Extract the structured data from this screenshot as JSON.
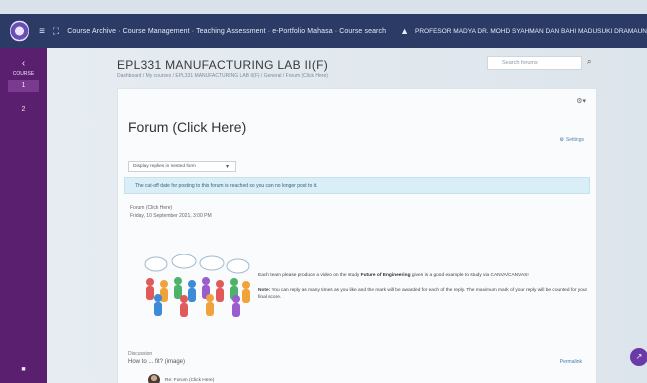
{
  "topbar": {
    "crumbs": "Course Archive  ·  Course Management  ·  Teaching Assessment  ·  e-Portfolio Mahasa  ·  Course search",
    "user": "PROFESOR MADYA DR. MOHD SYAHMAN DAN BAHI MADUSUKI DRAMAUN"
  },
  "sidebar": {
    "back_label": "COURSE",
    "items": [
      "1",
      "2"
    ]
  },
  "course": {
    "title": "EPL331 MANUFACTURING LAB II(F)",
    "breadcrumb": "Dashboard  /  My courses  /  EPL331 MANUFACTURING LAB II(F)  /  General  /  Forum (Click Here)"
  },
  "search": {
    "placeholder": "Search forums"
  },
  "forum": {
    "title": "Forum (Click Here)",
    "settings_label": "Settings",
    "display_mode": "Display replies in nested form",
    "notice": "The cut-off date for posting to this forum is reached so you can no longer post to it.",
    "post_author": "Forum (Click Here)",
    "post_date": "Friday, 10 September 2021, 3:00 PM",
    "post_body_prefix": "Each team please produce a video on the study ",
    "post_body_bold": "Future of Engineering",
    "post_body_suffix": " given is a good example to study via CANVA/CANVAS!",
    "note_bold": "Note:",
    "note_text": " You can reply as many times as you like and the mark will be awarded for each of the reply. The maximum mark of your reply will be counted for your final score.",
    "discussion_label": "Discussion",
    "discussion_row": "How to ... fit? (image)",
    "permalink": "Permalink",
    "reply_author": "Re: Forum (Click Here)"
  },
  "colors": {
    "topbar": "#2b3b66",
    "sidebar": "#5b1f6f",
    "notice_bg": "#d9eef6",
    "link": "#4a78b5"
  }
}
